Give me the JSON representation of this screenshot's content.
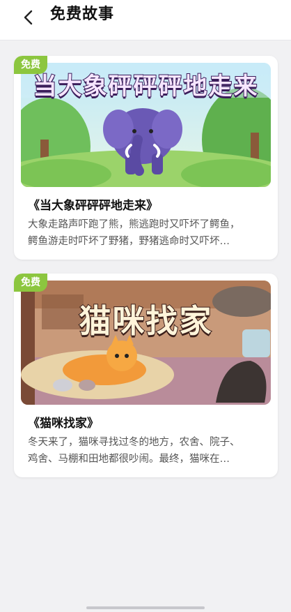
{
  "header": {
    "title": "免费故事",
    "back_icon": "chevron-left-icon"
  },
  "stories": [
    {
      "badge": "免费",
      "cover_title": "当大象砰砰砰地走来",
      "title": "《当大象砰砰砰地走来》",
      "desc_line1": "大象走路声吓跑了熊，熊逃跑时又吓坏了鳄鱼，",
      "desc_line2": "鳄鱼游走时吓坏了野猪，野猪逃命时又吓坏…"
    },
    {
      "badge": "免费",
      "cover_title": "猫咪找家",
      "title": "《猫咪找家》",
      "desc_line1": "冬天来了，猫咪寻找过冬的地方，农舍、院子、",
      "desc_line2": "鸡舍、马棚和田地都很吵闹。最终，猫咪在…"
    }
  ],
  "colors": {
    "badge_bg": "#8cc63f",
    "page_bg": "#f1f1f3"
  }
}
